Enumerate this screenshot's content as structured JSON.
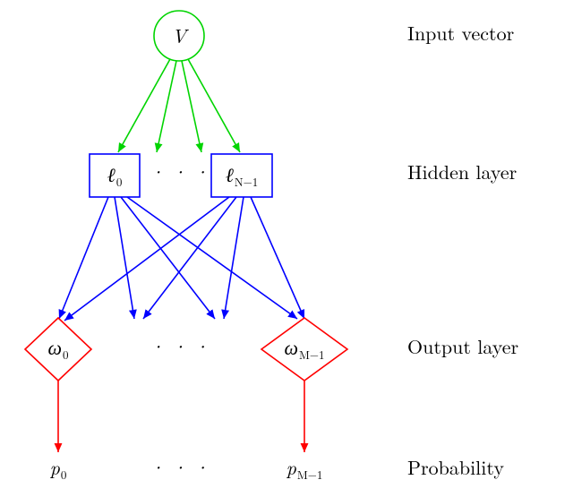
{
  "labels": {
    "input": "Input vector",
    "hidden": "Hidden layer",
    "output": "Output layer",
    "prob": "Probability"
  },
  "nodes": {
    "V": "V",
    "l0": "ℓ",
    "l0_sub": "0",
    "lN": "ℓ",
    "lN_sub": "N−1",
    "w0": "ω",
    "w0_sub": "0",
    "wM": "ω",
    "wM_sub": "M−1",
    "p0": "p",
    "p0_sub": "0",
    "pM": "p",
    "pM_sub": "M−1",
    "dots": "· · ·"
  },
  "colors": {
    "green": "#00d400",
    "blue": "#0000ff",
    "red": "#ff0000"
  },
  "chart_data": {
    "type": "table",
    "description": "Feedforward neural network diagram",
    "layers": [
      {
        "name": "Input vector",
        "nodes": [
          "V"
        ],
        "color": "green",
        "shape": "circle"
      },
      {
        "name": "Hidden layer",
        "nodes": [
          "ℓ_0",
          "…",
          "ℓ_{N−1}"
        ],
        "color": "blue",
        "shape": "square"
      },
      {
        "name": "Output layer",
        "nodes": [
          "ω_0",
          "…",
          "ω_{M−1}"
        ],
        "color": "red",
        "shape": "diamond"
      },
      {
        "name": "Probability",
        "nodes": [
          "p_0",
          "…",
          "p_{M−1}"
        ],
        "color": "black",
        "shape": "text"
      }
    ],
    "edges": [
      {
        "from": "V",
        "to": "ℓ_i (all hidden units)",
        "color": "green"
      },
      {
        "from": "ℓ_i (each hidden unit)",
        "to": "ω_j (all output units)",
        "color": "blue"
      },
      {
        "from": "ω_j",
        "to": "p_j",
        "color": "red"
      }
    ]
  }
}
